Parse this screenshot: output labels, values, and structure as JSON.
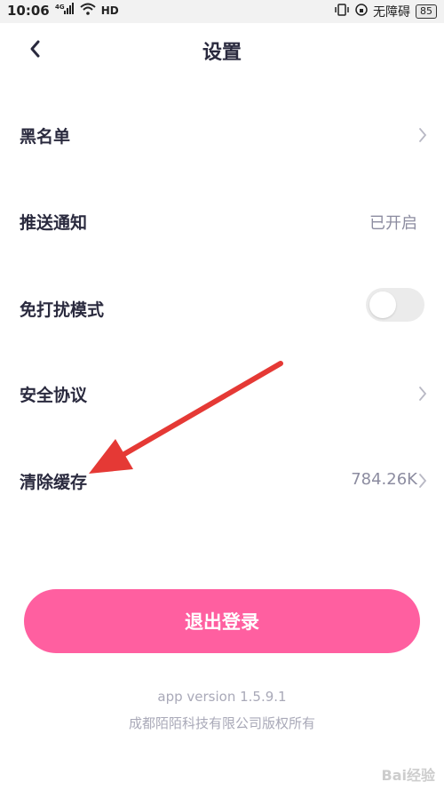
{
  "status_bar": {
    "time": "10:06",
    "signal_text": "4G",
    "hd_text": "HD",
    "accessibility_text": "无障碍",
    "battery": "85"
  },
  "header": {
    "title": "设置"
  },
  "settings": {
    "blacklist_label": "黑名单",
    "push_label": "推送通知",
    "push_value": "已开启",
    "dnd_label": "免打扰模式",
    "dnd_enabled": false,
    "security_label": "安全协议",
    "cache_label": "清除缓存",
    "cache_value": "784.26K"
  },
  "actions": {
    "logout_label": "退出登录"
  },
  "footer": {
    "version": "app version 1.5.9.1",
    "copyright": "成都陌陌科技有限公司版权所有"
  },
  "watermark": "Bai经验",
  "colors": {
    "accent": "#ff5fa0",
    "annotation_arrow": "#e53935"
  }
}
